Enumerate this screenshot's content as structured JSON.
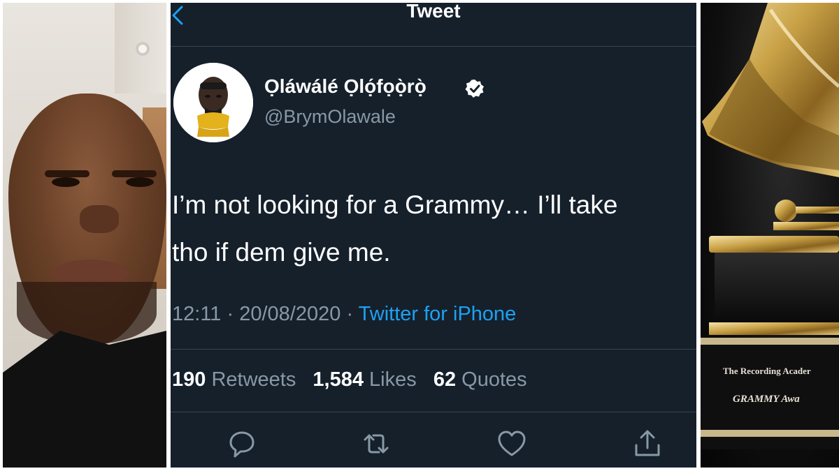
{
  "header": {
    "title": "Tweet"
  },
  "tweet": {
    "display_name": "Ọláwálé  Ọlọ́fọọ̀rọ̀",
    "handle": "@BrymOlawale",
    "text_line1": "I’m not looking for a Grammy… I’ll take",
    "text_line2": "tho if dem give me.",
    "time": "12:11",
    "date": "20/08/2020",
    "separator": "·",
    "source": "Twitter for iPhone",
    "retweets_count": "190",
    "retweets_label": "Retweets",
    "likes_count": "1,584",
    "likes_label": "Likes",
    "quotes_count": "62",
    "quotes_label": "Quotes"
  },
  "right_photo": {
    "plaque_line1": "The Recording Acader",
    "plaque_line2": "GRAMMY Awa"
  },
  "colors": {
    "background": "#15202b",
    "text": "#ffffff",
    "secondary_text": "#8899a6",
    "accent": "#1da1f2",
    "divider": "#38444d"
  },
  "icons": [
    "back-chevron-icon",
    "verified-badge-icon",
    "reply-icon",
    "retweet-icon",
    "like-heart-icon",
    "share-icon"
  ]
}
